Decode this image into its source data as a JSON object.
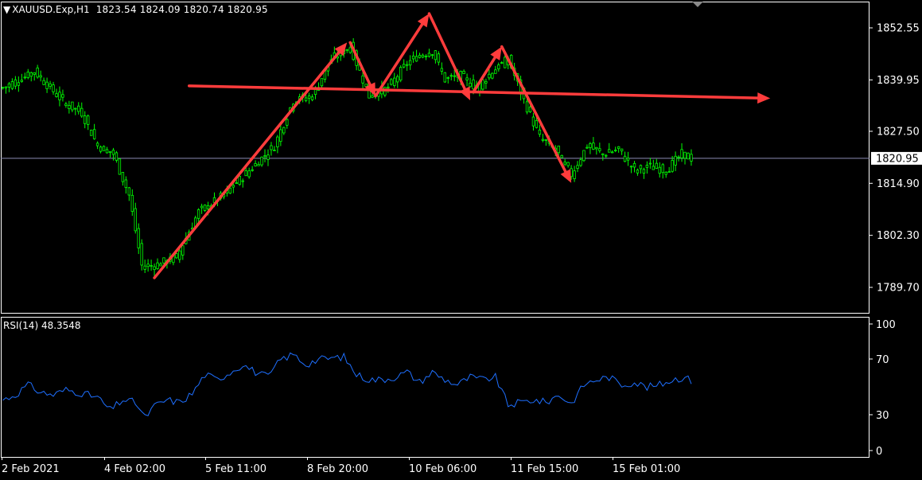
{
  "header": {
    "symbol_timeframe": "XAUUSD.Exp,H1",
    "ohlc": "1823.54 1824.09 1820.74 1820.95",
    "current_price_label": "1820.95"
  },
  "rsi": {
    "label": "RSI(14) 48.3548"
  },
  "colors": {
    "background": "#000000",
    "candle": "#00ff00",
    "rsi_line": "#1e6fff",
    "annotation": "#ff3c3c",
    "grid_frame": "#ffffff",
    "bid_line": "#8c8cb4"
  },
  "chart_data": [
    {
      "type": "candlestick",
      "title": "XAUUSD.Exp,H1",
      "ylim": [
        1785.0,
        1859.0
      ],
      "y_ticks": [
        "1852.55",
        "1839.95",
        "1827.50",
        "1814.90",
        "1802.30",
        "1789.70"
      ],
      "x_ticks": [
        "2 Feb 2021",
        "4 Feb 02:00",
        "5 Feb 11:00",
        "8 Feb 20:00",
        "10 Feb 06:00",
        "11 Feb 15:00",
        "15 Feb 01:00"
      ],
      "current_price": 1820.95,
      "price_path_anchors": [
        [
          0,
          1838
        ],
        [
          5,
          1840
        ],
        [
          10,
          1842
        ],
        [
          15,
          1838
        ],
        [
          20,
          1834
        ],
        [
          25,
          1832
        ],
        [
          30,
          1824
        ],
        [
          35,
          1822
        ],
        [
          40,
          1812
        ],
        [
          44,
          1795
        ],
        [
          48,
          1795
        ],
        [
          55,
          1797
        ],
        [
          62,
          1808
        ],
        [
          70,
          1812
        ],
        [
          78,
          1818
        ],
        [
          86,
          1824
        ],
        [
          92,
          1835
        ],
        [
          98,
          1836
        ],
        [
          104,
          1845
        ],
        [
          110,
          1848
        ],
        [
          116,
          1836
        ],
        [
          122,
          1838
        ],
        [
          128,
          1844
        ],
        [
          132,
          1846
        ],
        [
          136,
          1847
        ],
        [
          140,
          1840
        ],
        [
          145,
          1841
        ],
        [
          150,
          1838
        ],
        [
          155,
          1842
        ],
        [
          160,
          1845
        ],
        [
          165,
          1835
        ],
        [
          170,
          1826
        ],
        [
          175,
          1823
        ],
        [
          180,
          1817
        ],
        [
          185,
          1824
        ],
        [
          190,
          1822
        ],
        [
          195,
          1823
        ],
        [
          200,
          1818
        ],
        [
          205,
          1819
        ],
        [
          210,
          1818
        ],
        [
          215,
          1822
        ],
        [
          218,
          1821
        ]
      ],
      "annotations": [
        {
          "type": "arrow",
          "from": [
            48,
            1792
          ],
          "to": [
            109,
            1849
          ]
        },
        {
          "type": "arrow",
          "from": [
            110,
            1849
          ],
          "to": [
            118,
            1836
          ]
        },
        {
          "type": "arrow",
          "from": [
            118,
            1836
          ],
          "to": [
            135,
            1856
          ]
        },
        {
          "type": "arrow",
          "from": [
            135,
            1856
          ],
          "to": [
            148,
            1835
          ]
        },
        {
          "type": "arrow",
          "from": [
            149,
            1837
          ],
          "to": [
            158,
            1848
          ]
        },
        {
          "type": "arrow",
          "from": [
            158,
            1848
          ],
          "to": [
            180,
            1815
          ]
        },
        {
          "type": "arrow",
          "from": [
            59,
            1838.5
          ],
          "to": [
            243,
            1835.5
          ]
        }
      ]
    },
    {
      "type": "line",
      "title": "RSI(14) 48.3548",
      "ylim": [
        0,
        100
      ],
      "y_ticks": [
        "100",
        "70",
        "30",
        "0"
      ],
      "anchors": [
        [
          0,
          40
        ],
        [
          4,
          44
        ],
        [
          8,
          52
        ],
        [
          12,
          46
        ],
        [
          16,
          44
        ],
        [
          20,
          48
        ],
        [
          24,
          46
        ],
        [
          30,
          42
        ],
        [
          34,
          32
        ],
        [
          38,
          40
        ],
        [
          42,
          38
        ],
        [
          45,
          26
        ],
        [
          48,
          35
        ],
        [
          52,
          40
        ],
        [
          56,
          38
        ],
        [
          60,
          45
        ],
        [
          64,
          60
        ],
        [
          68,
          56
        ],
        [
          72,
          62
        ],
        [
          76,
          68
        ],
        [
          80,
          62
        ],
        [
          84,
          58
        ],
        [
          88,
          72
        ],
        [
          92,
          76
        ],
        [
          96,
          68
        ],
        [
          100,
          72
        ],
        [
          104,
          73
        ],
        [
          108,
          74
        ],
        [
          112,
          60
        ],
        [
          116,
          56
        ],
        [
          120,
          56
        ],
        [
          124,
          58
        ],
        [
          128,
          62
        ],
        [
          132,
          54
        ],
        [
          136,
          62
        ],
        [
          140,
          56
        ],
        [
          144,
          52
        ],
        [
          148,
          58
        ],
        [
          152,
          56
        ],
        [
          156,
          58
        ],
        [
          160,
          36
        ],
        [
          164,
          38
        ],
        [
          168,
          40
        ],
        [
          172,
          38
        ],
        [
          176,
          44
        ],
        [
          180,
          37
        ],
        [
          184,
          52
        ],
        [
          188,
          56
        ],
        [
          192,
          58
        ],
        [
          196,
          52
        ],
        [
          200,
          54
        ],
        [
          204,
          50
        ],
        [
          208,
          52
        ],
        [
          212,
          56
        ],
        [
          216,
          58
        ],
        [
          218,
          55
        ]
      ]
    }
  ]
}
